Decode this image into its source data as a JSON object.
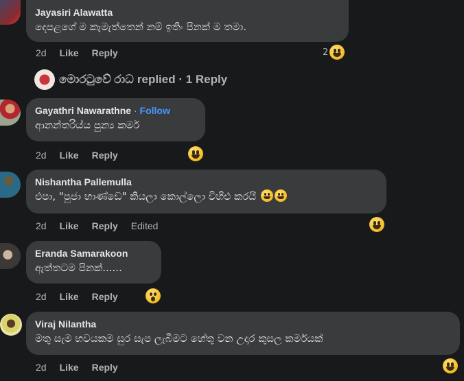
{
  "comments": [
    {
      "author": "Jayasiri Alawatta",
      "text": "දෙපළගේ ම කැමැත්තෙන් නම් ඉතිං පිනක් ම තමා.",
      "time": "2d",
      "like": "Like",
      "reply": "Reply",
      "reaction_count": "2"
    },
    {
      "author": "Gayathri Nawarathne",
      "follow": "Follow",
      "separator": "·",
      "text": "ආනන්තරිය්ය පුන්‍ය කර්ම",
      "time": "2d",
      "like": "Like",
      "reply": "Reply"
    },
    {
      "author": "Nishantha Pallemulla",
      "text": "එපා, \"පුජා භාණ්ඩෙ\" කියලා කොල්ලො විහිළු කරයි",
      "time": "2d",
      "like": "Like",
      "reply": "Reply",
      "edited": "Edited"
    },
    {
      "author": "Eranda Samarakoon",
      "text": "ඇත්තටම පිනක්......",
      "time": "2d",
      "like": "Like",
      "reply": "Reply"
    },
    {
      "author": "Viraj Nilantha",
      "text": "මතු සැම භවයකම සුර සැප ලැබීමට හේතු වන උදාර කුසල කර්මයක්",
      "time": "2d",
      "like": "Like",
      "reply": "Reply"
    }
  ],
  "replies_link": {
    "name": "මොරටුවේ රාධ",
    "text": "replied · 1 Reply"
  },
  "colors": {
    "background": "#18191a",
    "bubble": "#3a3b3c",
    "follow": "#4599ff",
    "muted": "#b0b3b8"
  },
  "icons": [
    "haha-reaction-icon",
    "wow-reaction-icon",
    "grin-emoji-icon"
  ]
}
